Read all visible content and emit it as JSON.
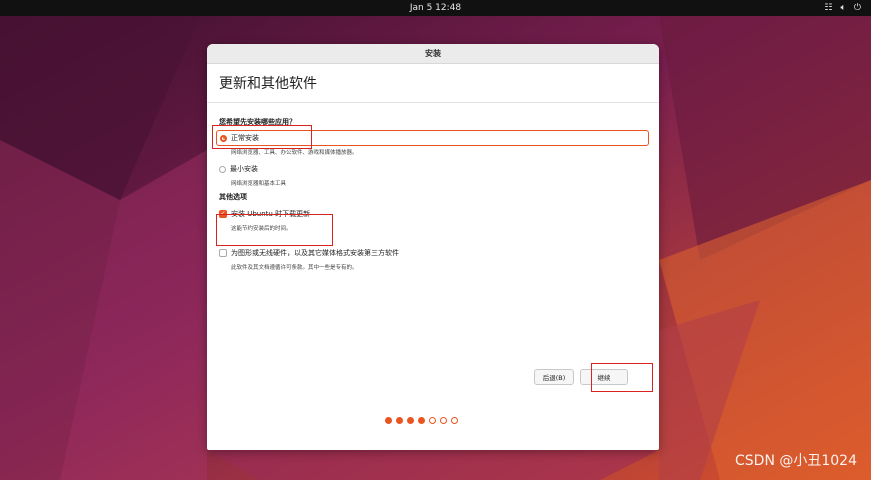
{
  "topbar": {
    "clock": "Jan 5  12:48",
    "tray_icons": [
      "network-icon",
      "volume-icon",
      "power-icon"
    ]
  },
  "window": {
    "title": "安装",
    "heading": "更新和其他软件"
  },
  "apps": {
    "question": "您希望先安装哪些应用？",
    "normal": {
      "label": "正常安装",
      "desc": "网络浏览器、工具、办公软件、游戏和媒体播放器。",
      "selected": true
    },
    "minimal": {
      "label": "最小安装",
      "desc": "网络浏览器和基本工具",
      "selected": false
    }
  },
  "other": {
    "title": "其他选项",
    "updates": {
      "label": "安装 Ubuntu 时下载更新",
      "desc": "这能节约安装后的时间。",
      "checked": true
    },
    "third_party": {
      "label": "为图形或无线硬件，以及其它媒体格式安装第三方软件",
      "desc": "此软件及其文档遵循许可条款。其中一些是专有的。",
      "checked": false
    }
  },
  "buttons": {
    "back": "后退(B)",
    "next": "继续"
  },
  "progress": {
    "total_steps": 7,
    "completed_steps": 4
  },
  "watermark": "CSDN @小丑1024",
  "colors": {
    "accent": "#e95420",
    "highlight_box": "#d9231e"
  }
}
